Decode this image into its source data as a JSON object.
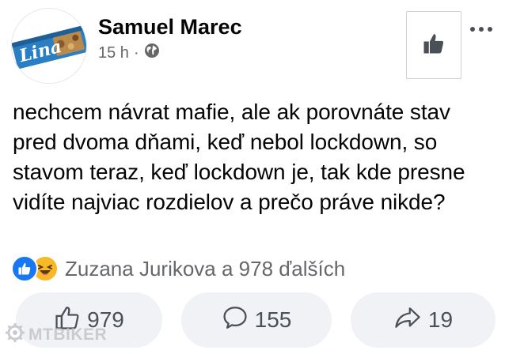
{
  "post": {
    "author": "Samuel Marec",
    "time": "15 h",
    "separator": "·",
    "avatar_text": "Lina",
    "text": "nechcem návrat mafie, ale ak porovnáte stav pred dvoma dňami, keď nebol lockdown, so stavom teraz, keď lockdown je, tak kde presne vidíte najviac rozdielov a prečo práve nikde?"
  },
  "reactions": {
    "summary": "Zuzana Jurikova a 978 ďalších",
    "icons": [
      "like-icon",
      "haha-icon"
    ]
  },
  "actions": {
    "like_count": "979",
    "comment_count": "155",
    "share_count": "19"
  },
  "watermark": {
    "text": "MTBIKER"
  },
  "colors": {
    "brand_blue": "#1877f2",
    "haha_yellow": "#f7b928",
    "secondary_text": "#65676b",
    "button_bg": "#f0f2f5"
  }
}
